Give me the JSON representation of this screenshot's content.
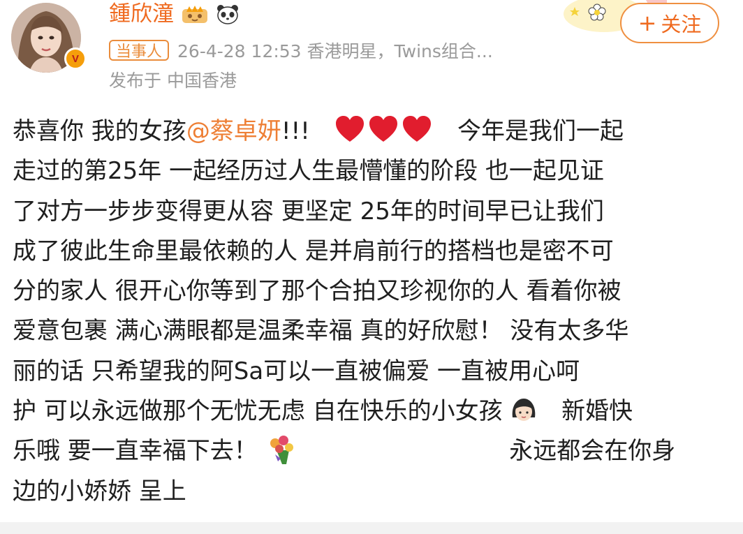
{
  "post": {
    "username": "鍾欣潼",
    "party_badge": "当事人",
    "meta": "26-4-28 12:53  香港明星，Twins组合...",
    "location": "发布于 中国香港",
    "follow_label": "关注",
    "lines": {
      "l1_pre": "恭喜你 我的女孩",
      "l1_mention": "@蔡卓妍",
      "l1_exclaim": "!!!",
      "l1_post": "今年是我们一起",
      "l2": "走过的第25年 一起经历过人生最懵懂的阶段 也一起见证",
      "l3": "了对方一步步变得更从容 更坚定 25年的时间早已让我们",
      "l4": "成了彼此生命里最依赖的人 是并肩前行的搭档也是密不可",
      "l5": "分的家人 很开心你等到了那个合拍又珍视你的人 看着你被",
      "l6": "爱意包裹 满心满眼都是温柔幸福 真的好欣慰！ 没有太多华",
      "l7": "丽的话 只希望我的阿Sa可以一直被偏爱 一直被用心呵",
      "l8_pre": "护 可以永远做那个无忧无虑 自在快乐的小女孩",
      "l8_post": "新婚快",
      "l9_pre": "乐哦 要一直幸福下去！",
      "l9_post": "永远都会在你身",
      "l10": "边的小娇娇 呈上"
    }
  },
  "icons": {
    "avatar": "avatar-portrait",
    "verified": "verified-badge-icon",
    "vip": "vip-crown-icon",
    "panda": "panda-icon",
    "heart": "red-heart-emoji",
    "girl": "girl-emoji",
    "bouquet": "bouquet-emoji",
    "plus": "plus-icon"
  },
  "colors": {
    "username": "#ef6a1f",
    "mention": "#ee7f35",
    "meta": "#9a9a9a",
    "follow_border": "#ef8f40",
    "heart": "#e11d2e"
  }
}
